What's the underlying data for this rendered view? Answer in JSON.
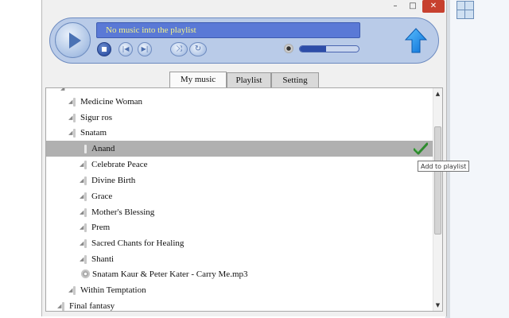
{
  "window": {
    "controls": {
      "minimize": "–",
      "maximize": "□",
      "close": "✕"
    }
  },
  "player": {
    "now_playing": "No music into the playlist",
    "volume_fraction": 0.45,
    "icons": [
      "play-icon",
      "stop-icon",
      "previous-icon",
      "next-icon",
      "shuffle-icon",
      "repeat-icon",
      "volume-icon",
      "upload-arrow-icon"
    ],
    "accent_color": "#5a79d6"
  },
  "tabs": [
    {
      "label": "My music",
      "active": true
    },
    {
      "label": "Playlist",
      "active": false
    },
    {
      "label": "Setting",
      "active": false
    }
  ],
  "tree": [
    {
      "label": "Medicine Woman",
      "type": "folder"
    },
    {
      "label": "Sigur ros",
      "type": "folder"
    },
    {
      "label": "Snatam",
      "type": "folder"
    },
    {
      "label": "Anand",
      "type": "folder",
      "selected": true
    },
    {
      "label": "Celebrate Peace",
      "type": "folder"
    },
    {
      "label": "Divine Birth",
      "type": "folder"
    },
    {
      "label": "Grace",
      "type": "folder"
    },
    {
      "label": "Mother's Blessing",
      "type": "folder"
    },
    {
      "label": "Prem",
      "type": "folder"
    },
    {
      "label": "Sacred Chants for Healing",
      "type": "folder"
    },
    {
      "label": "Shanti",
      "type": "folder"
    },
    {
      "label": "Snatam Kaur & Peter Kater - Carry Me.mp3",
      "type": "file"
    },
    {
      "label": "Within Temptation",
      "type": "folder"
    },
    {
      "label": "Final fantasy",
      "type": "folder"
    }
  ],
  "tooltip": "Add to playlist",
  "scrollbar": {
    "up": "▲",
    "down": "▼"
  }
}
